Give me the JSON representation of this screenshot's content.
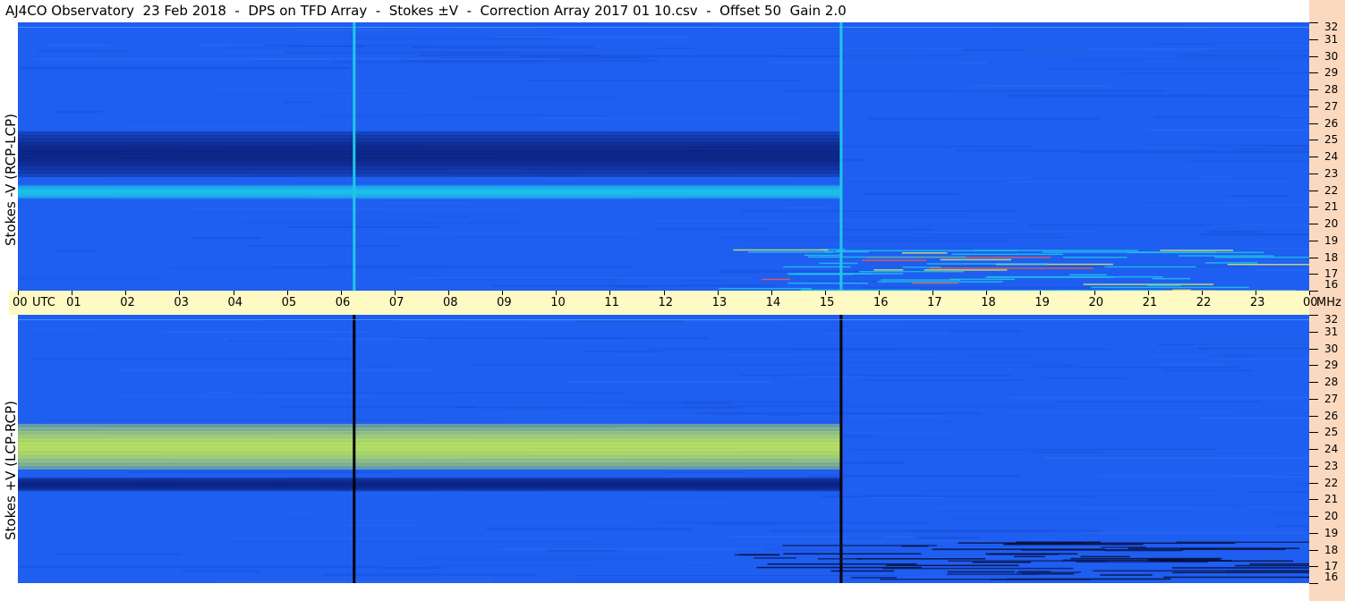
{
  "title": "AJ4CO Observatory  23 Feb 2018  -  DPS on TFD Array  -  Stokes ±V  -  Correction Array 2017 01 10.csv  -  Offset 50  Gain 2.0",
  "colors": {
    "background_blue": "#1e5ef0",
    "dark_blue": "#0a1e78",
    "cyan": "#1fc8e8",
    "yellow_green": "#c8f050",
    "time_band": "#fff9c4",
    "right_strip": "#fbd9bf"
  },
  "chart_data": [
    {
      "type": "heatmap",
      "panel": "top",
      "ylabel": "Stokes -V (RCP-LCP)",
      "x": [
        "00",
        "01",
        "02",
        "03",
        "04",
        "05",
        "06",
        "07",
        "08",
        "09",
        "10",
        "11",
        "12",
        "13",
        "14",
        "15",
        "16",
        "17",
        "18",
        "19",
        "20",
        "21",
        "22",
        "23",
        "00"
      ],
      "x_unit": "UTC",
      "y_ticks": [
        32,
        31,
        30,
        29,
        28,
        27,
        26,
        25,
        24,
        23,
        22,
        21,
        20,
        19,
        18,
        17,
        16
      ],
      "y_unit": "MHz",
      "ylim": [
        16,
        32
      ],
      "xlim": [
        0,
        24
      ],
      "grid": false,
      "features": [
        {
          "kind": "dark_band",
          "freq": [
            22.8,
            25.5
          ],
          "time": [
            0,
            15.3
          ]
        },
        {
          "kind": "bright_band",
          "freq": [
            21.5,
            22.3
          ],
          "time": [
            0,
            15.3
          ]
        },
        {
          "kind": "vertical_line",
          "time": 6.25,
          "color": "cyan"
        },
        {
          "kind": "vertical_line",
          "time": 15.3,
          "color": "cyan"
        },
        {
          "kind": "bright_region",
          "freq": [
            16,
            18.5
          ],
          "time": [
            13,
            24
          ]
        }
      ]
    },
    {
      "type": "heatmap",
      "panel": "bottom",
      "ylabel": "Stokes +V (LCP-RCP)",
      "x": [
        "00",
        "01",
        "02",
        "03",
        "04",
        "05",
        "06",
        "07",
        "08",
        "09",
        "10",
        "11",
        "12",
        "13",
        "14",
        "15",
        "16",
        "17",
        "18",
        "19",
        "20",
        "21",
        "22",
        "23",
        "00"
      ],
      "x_unit": "UTC",
      "y_ticks": [
        32,
        31,
        30,
        29,
        28,
        27,
        26,
        25,
        24,
        23,
        22,
        21,
        20,
        19,
        18,
        17,
        16
      ],
      "y_unit": "MHz",
      "ylim": [
        16,
        32
      ],
      "xlim": [
        0,
        24
      ],
      "grid": false,
      "features": [
        {
          "kind": "bright_band",
          "freq": [
            22.8,
            25.5
          ],
          "time": [
            0,
            15.3
          ]
        },
        {
          "kind": "dark_band",
          "freq": [
            21.5,
            22.3
          ],
          "time": [
            0,
            15.3
          ]
        },
        {
          "kind": "vertical_line",
          "time": 6.25,
          "color": "black"
        },
        {
          "kind": "vertical_line",
          "time": 15.3,
          "color": "black"
        },
        {
          "kind": "dark_region",
          "freq": [
            16,
            18.5
          ],
          "time": [
            13,
            24
          ]
        }
      ]
    }
  ]
}
